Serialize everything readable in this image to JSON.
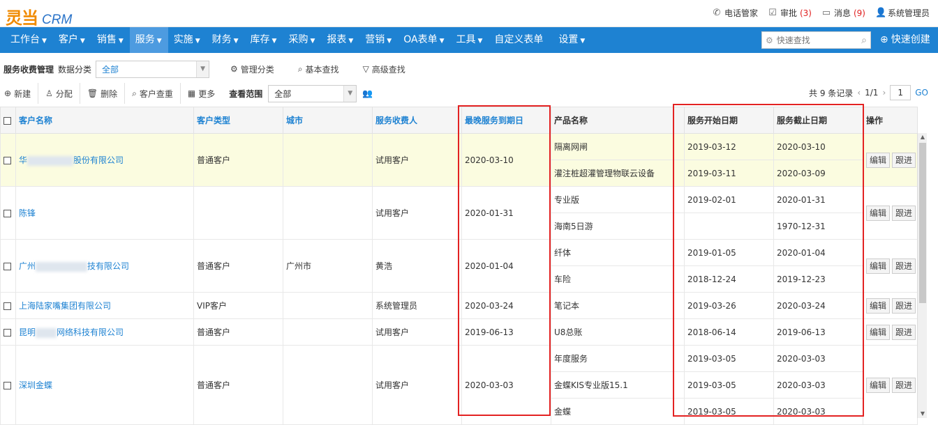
{
  "app": {
    "logo_text": "灵当",
    "logo_crm": "CRM"
  },
  "topbar": {
    "phone": "电话管家",
    "approval": "审批",
    "approval_count": "(3)",
    "messages": "消息",
    "messages_count": "(9)",
    "user": "系统管理员"
  },
  "nav": {
    "items": [
      {
        "label": "工作台"
      },
      {
        "label": "客户"
      },
      {
        "label": "销售"
      },
      {
        "label": "服务"
      },
      {
        "label": "实施"
      },
      {
        "label": "财务"
      },
      {
        "label": "库存"
      },
      {
        "label": "采购"
      },
      {
        "label": "报表"
      },
      {
        "label": "营销"
      },
      {
        "label": "OA表单"
      },
      {
        "label": "工具"
      },
      {
        "label": "自定义表单"
      },
      {
        "label": "设置"
      }
    ],
    "search_placeholder": "快速查找",
    "quick_create": "快速创建"
  },
  "filter": {
    "title": "服务收费管理",
    "category_label": "数据分类",
    "category_value": "全部",
    "manage": "管理分类",
    "basic_search": "基本查找",
    "advanced_search": "高级查找"
  },
  "toolbar": {
    "new": "新建",
    "assign": "分配",
    "delete": "删除",
    "dedupe": "客户查重",
    "more": "更多",
    "scope_label": "查看范围",
    "scope_value": "全部",
    "records": "共 9 条记录",
    "page": "1/1",
    "page_input": "1",
    "go": "GO"
  },
  "table": {
    "headers": {
      "name": "客户名称",
      "type": "客户类型",
      "city": "城市",
      "payer": "服务收费人",
      "latest": "最晚服务到期日",
      "product": "产品名称",
      "start": "服务开始日期",
      "end": "服务截止日期",
      "ops": "操作"
    },
    "edit": "编辑",
    "follow": "跟进",
    "rows": [
      {
        "name_a": "华",
        "name_b": "股份有限公司",
        "type": "普通客户",
        "city": "",
        "payer": "试用客户",
        "latest": "2020-03-10",
        "products": [
          {
            "p": "隔离网闸",
            "s": "2019-03-12",
            "e": "2020-03-10"
          },
          {
            "p": "灌注桩超灌管理物联云设备",
            "s": "2019-03-11",
            "e": "2020-03-09"
          }
        ]
      },
      {
        "name_a": "陈锋",
        "name_b": "",
        "type": "",
        "city": "",
        "payer": "试用客户",
        "latest": "2020-01-31",
        "products": [
          {
            "p": "专业版",
            "s": "2019-02-01",
            "e": "2020-01-31"
          },
          {
            "p": "海南5日游",
            "s": "",
            "e": "1970-12-31"
          }
        ]
      },
      {
        "name_a": "广州",
        "name_b": "技有限公司",
        "type": "普通客户",
        "city": "广州市",
        "payer": "黄浩",
        "latest": "2020-01-04",
        "products": [
          {
            "p": "纤体",
            "s": "2019-01-05",
            "e": "2020-01-04"
          },
          {
            "p": "车险",
            "s": "2018-12-24",
            "e": "2019-12-23"
          }
        ]
      },
      {
        "name_a": "上海陆家嘴集团有限公司",
        "name_b": "",
        "type": "VIP客户",
        "city": "",
        "payer": "系统管理员",
        "latest": "2020-03-24",
        "products": [
          {
            "p": "笔记本",
            "s": "2019-03-26",
            "e": "2020-03-24"
          }
        ]
      },
      {
        "name_a": "昆明",
        "name_b": "网络科技有限公司",
        "type": "普通客户",
        "city": "",
        "payer": "试用客户",
        "latest": "2019-06-13",
        "products": [
          {
            "p": "U8总账",
            "s": "2018-06-14",
            "e": "2019-06-13"
          }
        ]
      },
      {
        "name_a": "深圳金蝶",
        "name_b": "",
        "type": "普通客户",
        "city": "",
        "payer": "试用客户",
        "latest": "2020-03-03",
        "products": [
          {
            "p": "年度服务",
            "s": "2019-03-05",
            "e": "2020-03-03"
          },
          {
            "p": "金蝶KIS专业版15.1",
            "s": "2019-03-05",
            "e": "2020-03-03"
          },
          {
            "p": "金蝶",
            "s": "2019-03-05",
            "e": "2020-03-03"
          }
        ]
      }
    ]
  },
  "colors": {
    "nav_bg": "#1e82d2",
    "link": "#1e82d2",
    "highlight_row": "#fbfce0",
    "annotation_red": "#e32222",
    "logo_orange": "#f08a00"
  }
}
